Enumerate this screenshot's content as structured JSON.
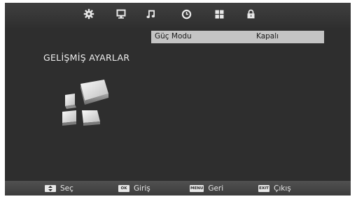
{
  "topbar": {
    "icons": [
      "gear-icon",
      "monitor-icon",
      "music-note-icon",
      "clock-icon",
      "apps-grid-icon",
      "lock-icon"
    ]
  },
  "settings": [
    {
      "label": "Güç Modu",
      "value": "Kapalı"
    }
  ],
  "section_title": "GELİŞMİŞ AYARLAR",
  "footer": {
    "hints": [
      {
        "key": "",
        "label": "Seç",
        "icon": "updown-key-icon"
      },
      {
        "key": "OK",
        "label": "Giriş",
        "icon": "ok-key-icon"
      },
      {
        "key": "MENU",
        "label": "Geri",
        "icon": "menu-key-icon"
      },
      {
        "key": "EXIT",
        "label": "Çıkış",
        "icon": "exit-key-icon"
      }
    ]
  },
  "colors": {
    "background": "#2e2e2e",
    "highlight_row": "#c4c4c4",
    "text": "#f0f0f0"
  }
}
